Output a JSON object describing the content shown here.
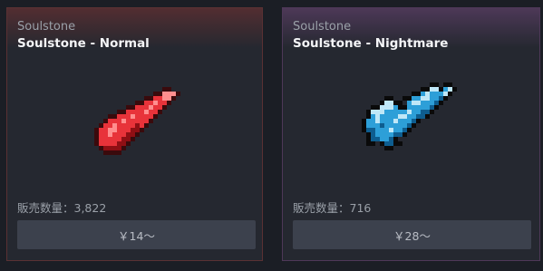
{
  "items": [
    {
      "category": "Soulstone",
      "name": "Soulstone - Normal",
      "sold": "販売数量：3,822",
      "price": "￥14～",
      "icon": "red-crystal-icon",
      "colors": {
        "main": "#e8333a",
        "dark": "#8f0f14",
        "light": "#ff8e8e",
        "edge": "#3a0a0c"
      }
    },
    {
      "category": "Soulstone",
      "name": "Soulstone - Nightmare",
      "sold": "販売数量：716",
      "price": "￥28～",
      "icon": "blue-crystal-icon",
      "colors": {
        "main": "#2d9fd8",
        "dark": "#0e5d8f",
        "light": "#bfe7f7",
        "edge": "#0a0a0a"
      }
    }
  ]
}
